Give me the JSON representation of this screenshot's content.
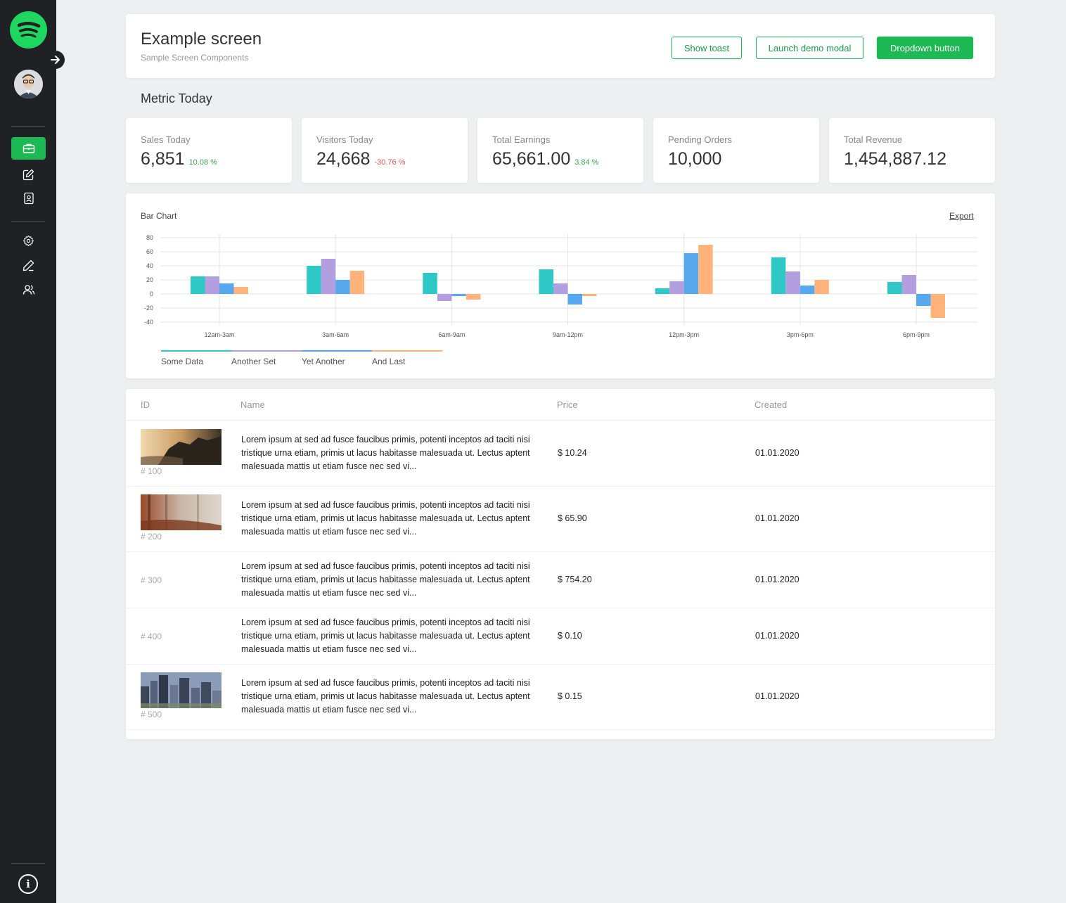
{
  "sidebar": {
    "logo": "spotify-logo",
    "nav_items": [
      {
        "icon": "briefcase-icon",
        "active": true
      },
      {
        "icon": "edit-icon",
        "active": false
      },
      {
        "icon": "contact-icon",
        "active": false
      },
      {
        "icon": "gear-icon",
        "active": false
      },
      {
        "icon": "pen-icon",
        "active": false
      },
      {
        "icon": "users-icon",
        "active": false
      }
    ],
    "info_glyph": "i"
  },
  "header": {
    "title": "Example screen",
    "subtitle": "Sample Screen Components",
    "buttons": {
      "toast": "Show toast",
      "modal": "Launch demo modal",
      "dropdown": "Dropdown button"
    }
  },
  "metrics_section_title": "Metric Today",
  "metrics": [
    {
      "label": "Sales Today",
      "value": "6,851",
      "change": "10.08 %",
      "trend": "up"
    },
    {
      "label": "Visitors Today",
      "value": "24,668",
      "change": "-30.76 %",
      "trend": "down"
    },
    {
      "label": "Total Earnings",
      "value": "65,661.00",
      "change": "3.84 %",
      "trend": "up"
    },
    {
      "label": "Pending Orders",
      "value": "10,000",
      "change": "",
      "trend": ""
    },
    {
      "label": "Total Revenue",
      "value": "1,454,887.12",
      "change": "",
      "trend": ""
    }
  ],
  "chart": {
    "title": "Bar Chart",
    "export_label": "Export"
  },
  "chart_data": {
    "type": "bar",
    "categories": [
      "12am-3am",
      "3am-6am",
      "6am-9am",
      "9am-12pm",
      "12pm-3pm",
      "3pm-6pm",
      "6pm-9pm"
    ],
    "series": [
      {
        "name": "Some Data",
        "color": "#2ec9c6",
        "values": [
          25,
          40,
          30,
          35,
          8,
          52,
          17
        ]
      },
      {
        "name": "Another Set",
        "color": "#b39ee0",
        "values": [
          25,
          50,
          -10,
          15,
          18,
          32,
          27
        ]
      },
      {
        "name": "Yet Another",
        "color": "#56a9ef",
        "values": [
          15,
          20,
          -3,
          -15,
          58,
          12,
          -17
        ]
      },
      {
        "name": "And Last",
        "color": "#ffb27a",
        "values": [
          10,
          33,
          -8,
          -3,
          70,
          20,
          -34
        ]
      }
    ],
    "yticks": [
      80,
      60,
      40,
      20,
      0,
      -20,
      -40
    ],
    "ylim": [
      -40,
      80
    ],
    "grid": true,
    "legend_position": "bottom-left"
  },
  "table": {
    "columns": [
      "ID",
      "Name",
      "Price",
      "Created"
    ],
    "rows": [
      {
        "id": "# 100",
        "image": "coast-sunset",
        "name": "Lorem ipsum at sed ad fusce faucibus primis, potenti inceptos ad taciti nisi tristique urna etiam, primis ut lacus habitasse malesuada ut. Lectus aptent malesuada mattis ut etiam fusce nec sed vi...",
        "price": "$ 10.24",
        "created": "01.01.2020"
      },
      {
        "id": "# 200",
        "image": "autumn-forest",
        "name": "Lorem ipsum at sed ad fusce faucibus primis, potenti inceptos ad taciti nisi tristique urna etiam, primis ut lacus habitasse malesuada ut. Lectus aptent malesuada mattis ut etiam fusce nec sed vi...",
        "price": "$ 65.90",
        "created": "01.01.2020"
      },
      {
        "id": "# 300",
        "image": "",
        "name": "Lorem ipsum at sed ad fusce faucibus primis, potenti inceptos ad taciti nisi tristique urna etiam, primis ut lacus habitasse malesuada ut. Lectus aptent malesuada mattis ut etiam fusce nec sed vi...",
        "price": "$ 754.20",
        "created": "01.01.2020"
      },
      {
        "id": "# 400",
        "image": "",
        "name": "Lorem ipsum at sed ad fusce faucibus primis, potenti inceptos ad taciti nisi tristique urna etiam, primis ut lacus habitasse malesuada ut. Lectus aptent malesuada mattis ut etiam fusce nec sed vi...",
        "price": "$ 0.10",
        "created": "01.01.2020"
      },
      {
        "id": "# 500",
        "image": "city-skyline",
        "name": "Lorem ipsum at sed ad fusce faucibus primis, potenti inceptos ad taciti nisi tristique urna etiam, primis ut lacus habitasse malesuada ut. Lectus aptent malesuada mattis ut etiam fusce nec sed vi...",
        "price": "$ 0.15",
        "created": "01.01.2020"
      }
    ]
  }
}
